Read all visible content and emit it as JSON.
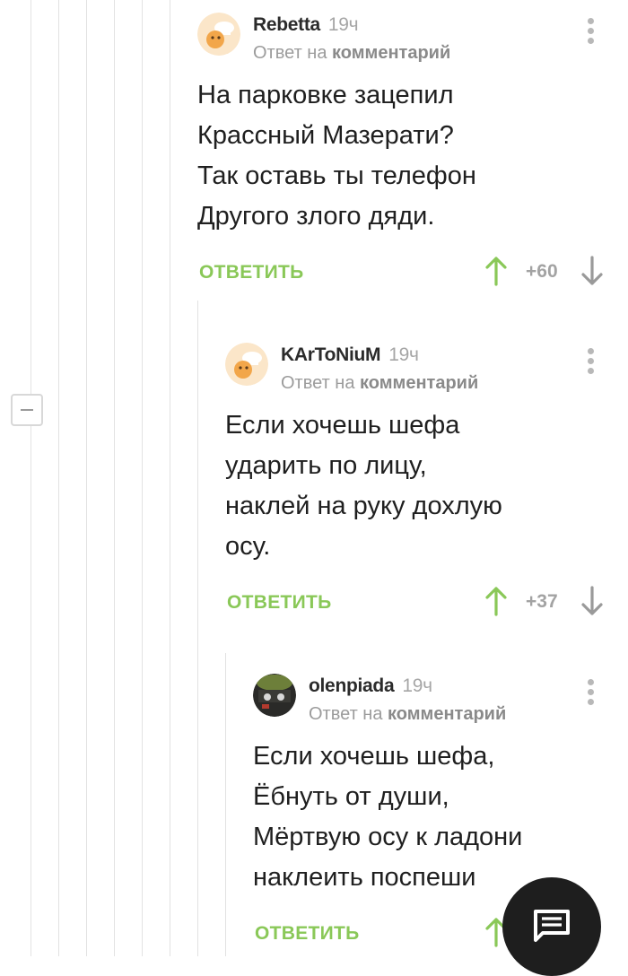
{
  "comments": [
    {
      "author": "Rebetta",
      "time": "19ч",
      "reply_prefix": "Ответ на",
      "reply_target": "комментарий",
      "lines": [
        "На парковке зацепил",
        "Крассный Мазерати?",
        "Так оставь ты телефон",
        "Другого злого дяди."
      ],
      "reply_label": "ОТВЕТИТЬ",
      "rating": "+60",
      "avatar_icon": "chef-avatar-icon"
    },
    {
      "author": "KArToNiuM",
      "time": "19ч",
      "reply_prefix": "Ответ на",
      "reply_target": "комментарий",
      "lines": [
        "Если хочешь шефа",
        "ударить по лицу,",
        "наклей на руку дохлую",
        "осу."
      ],
      "reply_label": "ОТВЕТИТЬ",
      "rating": "+37",
      "avatar_icon": "chef-avatar-icon"
    },
    {
      "author": "olenpiada",
      "time": "19ч",
      "reply_prefix": "Ответ на",
      "reply_target": "комментарий",
      "lines": [
        "Если хочешь шефа,",
        "Ёбнуть от души,",
        "Мёртвую осу к ладони",
        "наклеить поспеши"
      ],
      "reply_label": "ОТВЕТИТЬ",
      "rating": "",
      "avatar_icon": "photo-avatar-icon"
    }
  ],
  "colors": {
    "accent_green": "#8ac858",
    "thread_line": "#e2e2e2",
    "fab_background": "#1e1e1e"
  },
  "icons": {
    "collapse": "minus-icon",
    "fab": "chat-icon",
    "more": "more-vertical-icon",
    "upvote": "arrow-up-icon",
    "downvote": "arrow-down-icon"
  }
}
